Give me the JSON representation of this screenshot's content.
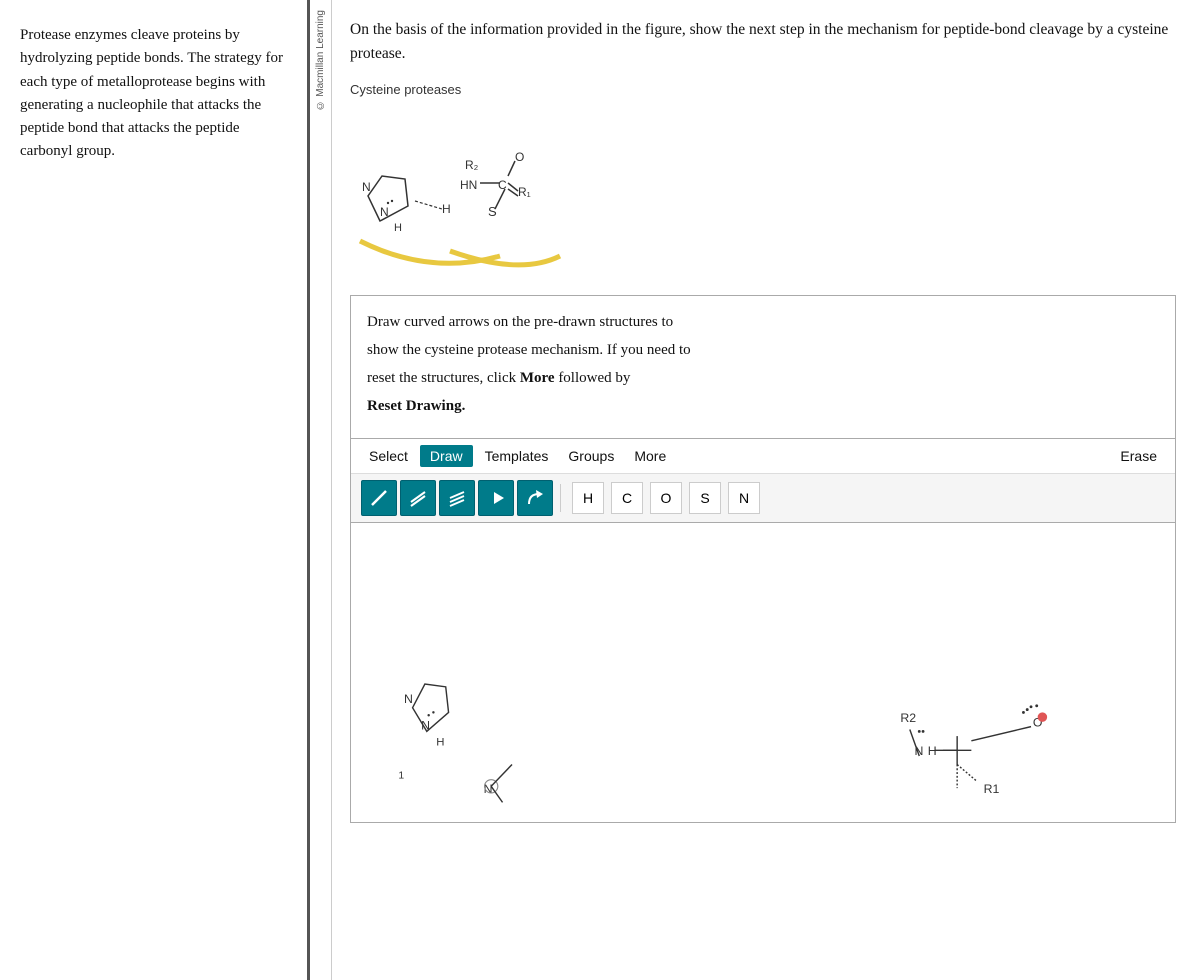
{
  "left": {
    "text": "Protease enzymes cleave proteins by hydrolyzing peptide bonds. The strategy for each type of metalloprotease begins with generating a nucleophile that attacks the peptide bond that attacks the peptide carbonyl group."
  },
  "vertical_label": "© Macmillan Learning",
  "right": {
    "question": "On the basis of the information provided in the figure, show the next step in the mechanism for peptide-bond cleavage by a cysteine protease.",
    "figure_label": "Cysteine proteases",
    "instruction": {
      "line1": "Draw curved arrows on the pre-drawn structures to",
      "line2": "show the cysteine protease mechanism. If you need to",
      "line3": "reset the structures, click ",
      "bold1": "More",
      "line3b": " followed by",
      "line4_bold": "Reset Drawing."
    },
    "toolbar": {
      "select_label": "Select",
      "draw_label": "Draw",
      "templates_label": "Templates",
      "groups_label": "Groups",
      "more_label": "More",
      "erase_label": "Erase"
    },
    "atoms": [
      "H",
      "C",
      "O",
      "S",
      "N"
    ]
  },
  "colors": {
    "teal": "#007b8a",
    "accent_red": "#e05555",
    "bond_yellow": "#e8c840"
  }
}
